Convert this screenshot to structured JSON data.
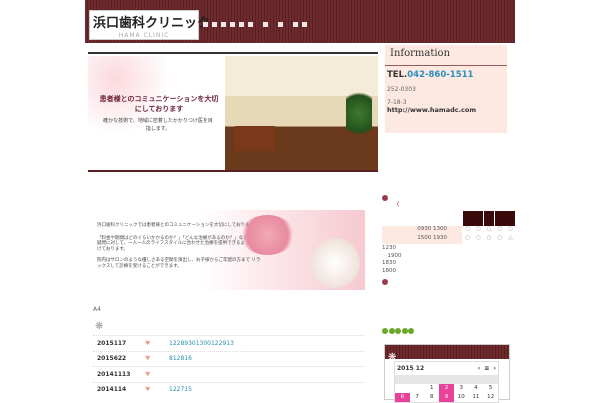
{
  "header": {
    "logo_jp": "浜口歯科クリニック",
    "logo_en": "HAMA CLINIC",
    "nav_count": 10
  },
  "banner": {
    "headline": "患者様とのコミュニケーションを大切にしております",
    "sub": "確かな技術で、地域に密着したかかりつけ医を目指します。"
  },
  "info": {
    "title": "Information",
    "tel_label": "TEL.",
    "tel": "042-860-1511",
    "zip": "252-0303",
    "address": "7-18-3",
    "url": "http://www.hamadc.com"
  },
  "intro": {
    "p1": "浜口歯科クリニックでは患者様とのコミュニケーションを大切にしております。",
    "p2": "「料金や期間はどのぐらいかかるのか？」「どんな治療があるのか？」など様々な疑問に対して、一人一人のライフスタイルに合わせた治療を提供できるよう心がけております。",
    "p3": "院内はサロンのような優しさある空間を演出し、お子様からご年配の方まで リラックスして診療を受けることができます。"
  },
  "a4": "A4",
  "news": [
    {
      "date": "2015117",
      "icon": "♥",
      "text": "12289301300122913"
    },
    {
      "date": "2015622",
      "icon": "♥",
      "text": "812816"
    },
    {
      "date": "20141113",
      "icon": "♥",
      "text": ""
    },
    {
      "date": "2014114",
      "icon": "♥",
      "text": "122715"
    }
  ],
  "schedule": {
    "mark": "(",
    "rows": [
      {
        "time": "0930  1300",
        "marks": [
          "○",
          "○",
          "○",
          "○",
          "○"
        ]
      },
      {
        "time": "1500  1930",
        "marks": [
          "○",
          "○",
          "○",
          "○",
          "△"
        ]
      }
    ],
    "notes": [
      "1230",
      "　1900",
      "1830",
      "1800"
    ]
  },
  "calendar": {
    "month": "2015 12",
    "prev": "‹",
    "mid": "≡",
    "next": "›",
    "days": [
      "",
      "",
      "1",
      "2",
      "3",
      "4",
      "5",
      "6",
      "7",
      "8",
      "9",
      "10",
      "11",
      "12"
    ],
    "highlight": [
      "2",
      "6",
      "9"
    ]
  }
}
